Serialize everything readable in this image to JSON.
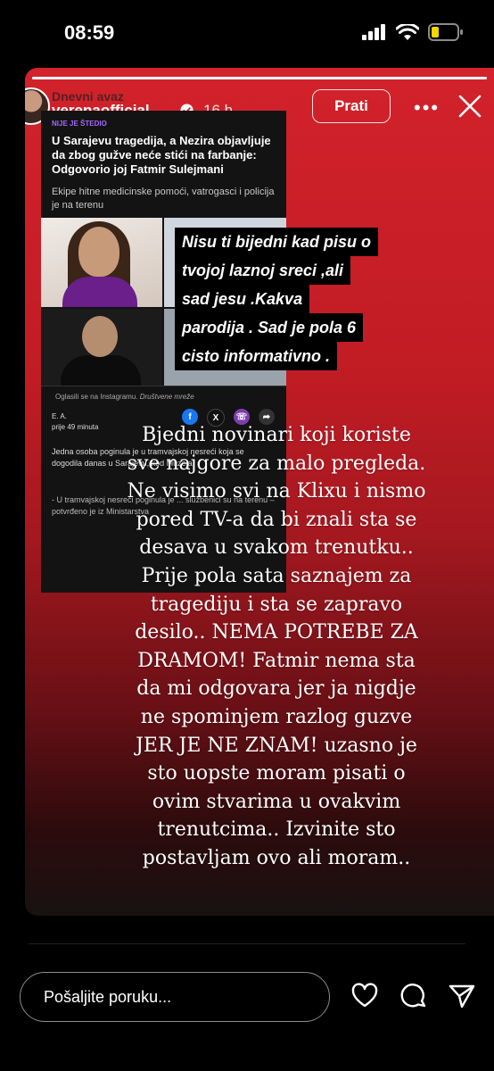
{
  "status_bar": {
    "time": "08:59",
    "battery_color": "#f5d400"
  },
  "story": {
    "progress_fraction": 1.0,
    "header": {
      "background_publication": "Dnevni avaz",
      "username": "verenaofficial_",
      "time_ago": "16 h",
      "follow_label": "Prati",
      "more_label": "•••"
    },
    "article": {
      "tag": "NIJE JE ŠTEDIO",
      "title": "U Sarajevu tragedija, a Nezira objavljuje da zbog gužve neće stići na farbanje: Odgovorio joj Fatmir Sulejmani",
      "subtitle": "Ekipe hitne medicinske pomoći, vatrogasci i policija je na terenu",
      "promo_text": "Oglasili se na Instagramu.",
      "promo_category": "Društvene mreže",
      "author": "E. A.",
      "published": "prije 49 minuta",
      "body_1": "Jedna osoba poginula je u tramvajskoj nesreći koja se dogodila danas u Sarajevu, kod Muzeja",
      "body_2": "- U tramvajskoj nesreći poginula je ... službenici su na terenu – potvrđeno je iz Ministarstva"
    },
    "caption_lines": [
      "Nisu ti bijedni kad pisu o",
      "tvojoj laznoj sreci ,ali",
      "sad jesu .Kakva",
      "parodija . Sad je pola 6",
      "cisto informativno ."
    ],
    "story_text_lines": [
      "Bjedni novinari koji koriste",
      "sve najgore za malo pregleda.",
      "Ne visimo svi na Klixu i nismo",
      "pored TV-a da bi znali sta se",
      "desava u svakom trenutku..",
      "Prije pola sata saznajem za",
      "tragediju i sta se zapravo",
      "desilo.. NEMA POTREBE ZA",
      "DRAMOM!  Fatmir nema sta",
      "da mi odgovara jer ja nigdje",
      "ne spominjem razlog guzve",
      "JER JE NE ZNAM! uzasno je",
      "sto uopste moram pisati o",
      "ovim stvarima u ovakvim",
      "trenutcima.. Izvinite sto",
      "postavljam ovo ali moram.."
    ]
  },
  "reply": {
    "placeholder": "Pošaljite poruku..."
  },
  "colors": {
    "story_red": "#d2222b",
    "caption_bg": "#000000",
    "article_bg": "#131313"
  }
}
